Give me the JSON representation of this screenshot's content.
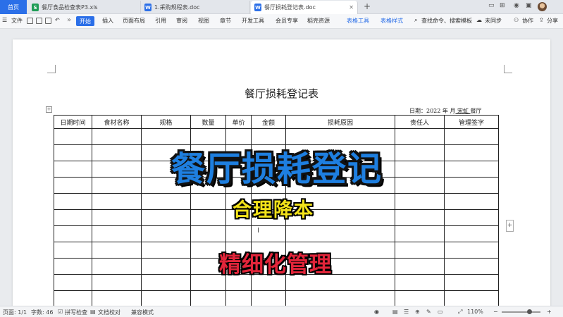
{
  "tabbar": {
    "home": "首页",
    "tabs": [
      {
        "icon": "S",
        "label": "餐厅食品检查表P3.xls"
      },
      {
        "icon": "W",
        "label": "1.采购规程表.doc"
      },
      {
        "icon": "W",
        "label": "餐厅损耗登记表.doc"
      }
    ],
    "add": "+"
  },
  "ribbon": {
    "file": "文件",
    "start": "开始",
    "items": [
      "插入",
      "页面布局",
      "引用",
      "审阅",
      "视图",
      "章节",
      "开发工具",
      "会员专享",
      "稻壳资源"
    ],
    "context": [
      "表格工具",
      "表格样式"
    ],
    "search": "查找命令、搜索模板",
    "sync": "未同步",
    "collab": "协作",
    "share": "分享"
  },
  "document": {
    "title": "餐厅损耗登记表",
    "date_label": "日期：2022 年  月",
    "date_blank": "   宋虹  ",
    "date_suffix": "餐厅",
    "headers": [
      "日期时间",
      "食材名称",
      "规格",
      "数量",
      "单价",
      "金额",
      "损耗原因",
      "责任人",
      "管理签字"
    ]
  },
  "overlay": {
    "line1": "餐厅损耗登记",
    "line2": "合理降本",
    "line3": "精细化管理",
    "colors": {
      "line1": "#1e7fe0",
      "line2": "#f2e21a",
      "line3": "#e2253a"
    }
  },
  "status": {
    "page": "页面: 1/1",
    "words": "字数: 46",
    "spell": "拼写检查",
    "proof": "文档校对",
    "mode": "兼容模式",
    "zoom": "110%"
  }
}
